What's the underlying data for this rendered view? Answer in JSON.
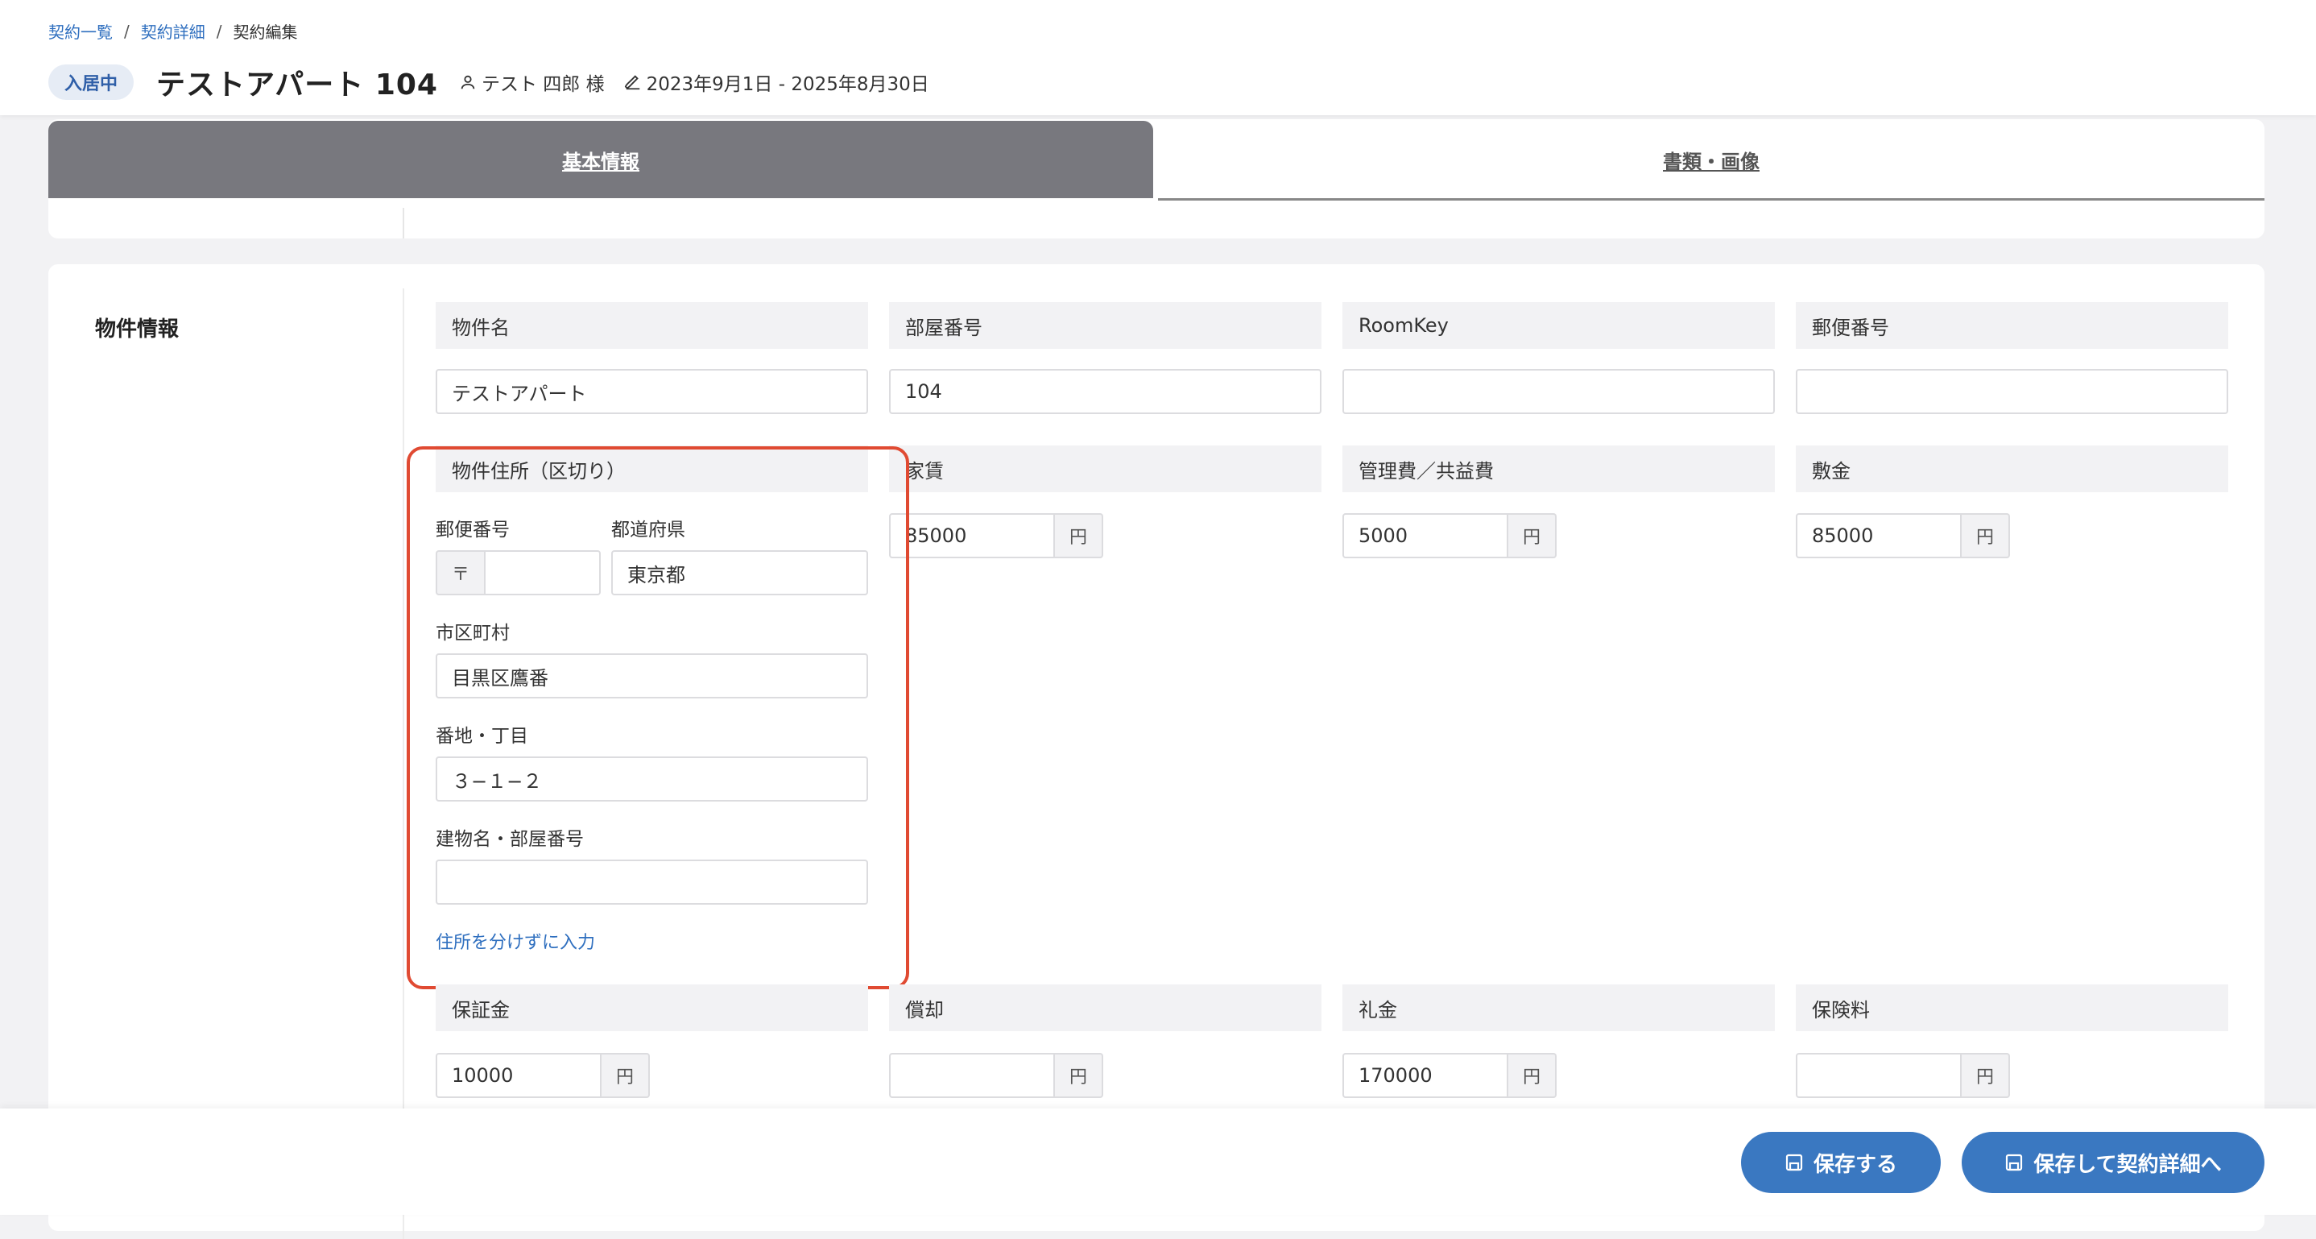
{
  "breadcrumb": {
    "items": [
      "契約一覧",
      "契約詳細",
      "契約編集"
    ],
    "separator": "/"
  },
  "header": {
    "status": "入居中",
    "title": "テストアパート 104",
    "tenant": "テスト 四郎 様",
    "period": "2023年9月1日 - 2025年8月30日"
  },
  "tabs": [
    {
      "label": "基本情報",
      "active": true
    },
    {
      "label": "書類・画像",
      "active": false
    }
  ],
  "section": {
    "title": "物件情報"
  },
  "fields": {
    "property_name": {
      "label": "物件名",
      "value": "テストアパート"
    },
    "room_number": {
      "label": "部屋番号",
      "value": "104"
    },
    "room_key": {
      "label": "RoomKey",
      "value": ""
    },
    "postal_code": {
      "label": "郵便番号",
      "value": ""
    },
    "address_split": {
      "label": "物件住所（区切り）",
      "postal_label": "郵便番号",
      "postal_prefix": "〒",
      "postal_value": "",
      "prefecture_label": "都道府県",
      "prefecture_value": "東京都",
      "city_label": "市区町村",
      "city_value": "目黒区鷹番",
      "street_label": "番地・丁目",
      "street_value": "３−１−２",
      "building_label": "建物名・部屋番号",
      "building_value": "",
      "toggle_link": "住所を分けずに入力"
    },
    "rent": {
      "label": "家賃",
      "value": "85000",
      "unit": "円"
    },
    "management_fee": {
      "label": "管理費／共益費",
      "value": "5000",
      "unit": "円"
    },
    "deposit": {
      "label": "敷金",
      "value": "85000",
      "unit": "円"
    },
    "guarantee": {
      "label": "保証金",
      "value": "10000",
      "unit": "円"
    },
    "amortization": {
      "label": "償却",
      "value": "",
      "unit": "円"
    },
    "key_money": {
      "label": "礼金",
      "value": "170000",
      "unit": "円"
    },
    "insurance": {
      "label": "保険料",
      "value": "",
      "unit": "円"
    }
  },
  "actions": {
    "save": "保存する",
    "save_and_detail": "保存して契約詳細へ"
  },
  "colors": {
    "accent": "#3a78c1",
    "highlight": "#e04a32",
    "tab_active": "#78787e"
  }
}
